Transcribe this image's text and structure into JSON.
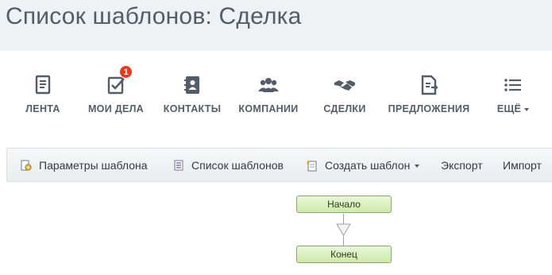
{
  "page": {
    "title": "Список шаблонов: Сделка"
  },
  "nav": {
    "items": [
      {
        "label": "ЛЕНТА",
        "icon": "feed-icon"
      },
      {
        "label": "МОИ ДЕЛА",
        "icon": "tasks-check-icon",
        "badge": "1"
      },
      {
        "label": "КОНТАКТЫ",
        "icon": "contact-book-icon"
      },
      {
        "label": "КОМПАНИИ",
        "icon": "people-group-icon"
      },
      {
        "label": "СДЕЛКИ",
        "icon": "handshake-icon"
      },
      {
        "label": "ПРЕДЛОЖЕНИЯ",
        "icon": "document-arrow-icon"
      },
      {
        "label": "ЕЩЁ",
        "icon": "menu-list-icon"
      }
    ]
  },
  "toolbar": {
    "items": [
      {
        "label": "Параметры шаблона",
        "icon": "settings-gear-icon"
      },
      {
        "label": "Список шаблонов",
        "icon": "list-icon"
      },
      {
        "label": "Создать шаблон",
        "icon": "new-document-icon"
      },
      {
        "label": "Экспорт"
      },
      {
        "label": "Импорт"
      }
    ]
  },
  "workflow": {
    "start_label": "Начало",
    "end_label": "Конец"
  },
  "colors": {
    "header_bg": "#eef2f4",
    "title_text": "#535c69",
    "badge": "#f0371b",
    "node_fill": "#d8efbf",
    "node_border": "#8aa868"
  }
}
